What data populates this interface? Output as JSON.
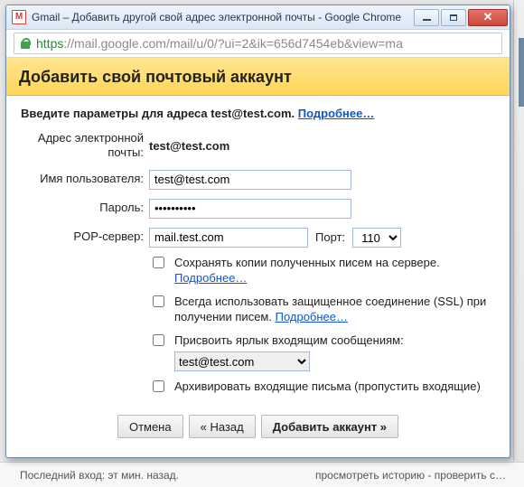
{
  "window": {
    "title": "Gmail – Добавить другой свой адрес электронной почты - Google Chrome"
  },
  "addressbar": {
    "scheme": "https",
    "host": "://mail.google.com",
    "path": "/mail/u/0/?ui=2&ik=656d7454eb&view=ma"
  },
  "header": {
    "title": "Добавить свой почтовый аккаунт"
  },
  "intro": {
    "prefix": "Введите параметры для адреса ",
    "email": "test@test.com",
    "suffix": ". ",
    "more": "Подробнее…"
  },
  "form": {
    "email_label": "Адрес электронной почты:",
    "email_value": "test@test.com",
    "user_label": "Имя пользователя:",
    "user_value": "test@test.com",
    "pass_label": "Пароль:",
    "pass_value": "••••••••••",
    "pop_label": "POP-сервер:",
    "pop_value": "mail.test.com",
    "port_label": "Порт:",
    "port_value": "110"
  },
  "checks": {
    "keep_copy": "Сохранять копии полученных писем на сервере.",
    "keep_copy_more": "Подробнее…",
    "ssl_line1": "Всегда использовать защищенное соединение (SSL) при",
    "ssl_line2": "получении писем.",
    "ssl_more": "Подробнее…",
    "label_msgs": "Присвоить ярлык входящим сообщениям:",
    "label_value": "test@test.com",
    "archive": "Архивировать входящие письма (пропустить входящие)"
  },
  "buttons": {
    "cancel": "Отмена",
    "back": "« Назад",
    "submit": "Добавить аккаунт »"
  },
  "background": {
    "left": "Последний вход: эт мин. назад.",
    "right": "просмотреть историю - проверить с…"
  }
}
